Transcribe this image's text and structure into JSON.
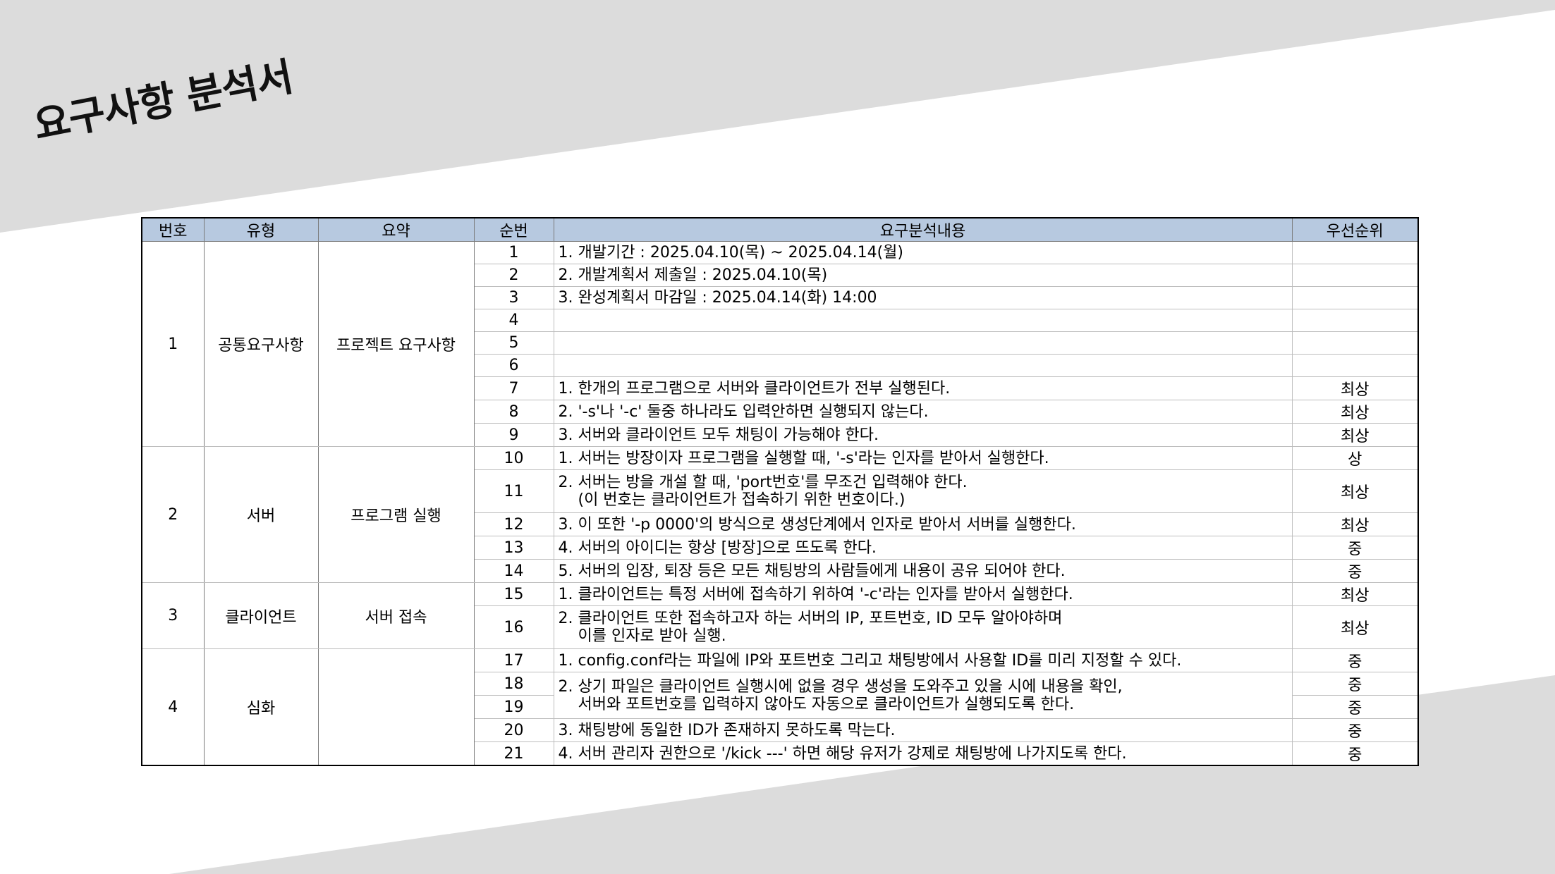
{
  "title": "요구사항 분석서",
  "colors": {
    "header_bg": "#b7c9e0",
    "band_gray": "#dcdcdc"
  },
  "table": {
    "headers": [
      "번호",
      "유형",
      "요약",
      "순번",
      "요구분석내용",
      "우선순위"
    ],
    "groups": [
      {
        "number": "1",
        "type": "공통요구사항",
        "summary": "프로젝트 요구사항",
        "rows": [
          {
            "seq": "1",
            "content": "1. 개발기간 : 2025.04.10(목) ~ 2025.04.14(월)",
            "priority": ""
          },
          {
            "seq": "2",
            "content": "2. 개발계획서 제출일 : 2025.04.10(목)",
            "priority": ""
          },
          {
            "seq": "3",
            "content": "3. 완성계획서 마감일 : 2025.04.14(화) 14:00",
            "priority": ""
          },
          {
            "seq": "4",
            "content": "",
            "priority": ""
          },
          {
            "seq": "5",
            "content": "",
            "priority": ""
          },
          {
            "seq": "6",
            "content": "",
            "priority": ""
          },
          {
            "seq": "7",
            "content": "1. 한개의 프로그램으로 서버와 클라이언트가 전부 실행된다.",
            "priority": "최상"
          },
          {
            "seq": "8",
            "content": "2. '-s'나 '-c' 둘중 하나라도 입력안하면 실행되지 않는다.",
            "priority": "최상"
          },
          {
            "seq": "9",
            "content": "3. 서버와 클라이언트 모두 채팅이 가능해야 한다.",
            "priority": "최상"
          }
        ]
      },
      {
        "number": "2",
        "type": "서버",
        "summary": "프로그램 실행",
        "rows": [
          {
            "seq": "10",
            "content": "1. 서버는 방장이자 프로그램을 실행할 때, '-s'라는 인자를 받아서 실행한다.",
            "priority": "상"
          },
          {
            "seq": "11",
            "content": "2. 서버는 방을 개설 할 때, 'port번호'를 무조건 입력해야 한다.\n    (이 번호는 클라이언트가 접속하기 위한 번호이다.)",
            "priority": "최상"
          },
          {
            "seq": "12",
            "content": "3. 이 또한 '-p 0000'의 방식으로 생성단계에서 인자로 받아서 서버를 실행한다.",
            "priority": "최상"
          },
          {
            "seq": "13",
            "content": "4. 서버의 아이디는 항상 [방장]으로 뜨도록 한다.",
            "priority": "중"
          },
          {
            "seq": "14",
            "content": "5. 서버의 입장, 퇴장 등은 모든 채팅방의 사람들에게 내용이 공유 되어야 한다.",
            "priority": "중"
          }
        ]
      },
      {
        "number": "3",
        "type": "클라이언트",
        "summary": "서버 접속",
        "rows": [
          {
            "seq": "15",
            "content": "1. 클라이언트는 특정 서버에 접속하기 위하여 '-c'라는 인자를 받아서 실행한다.",
            "priority": "최상"
          },
          {
            "seq": "16",
            "content": "2. 클라이언트 또한 접속하고자 하는 서버의 IP, 포트번호, ID 모두 알아야하며\n    이를 인자로 받아 실행.",
            "priority": "최상"
          }
        ]
      },
      {
        "number": "4",
        "type": "심화",
        "summary": "",
        "rows": [
          {
            "seq": "17",
            "content": "1. config.conf라는 파일에 IP와 포트번호 그리고 채팅방에서 사용할 ID를 미리 지정할 수 있다.",
            "priority": "중"
          },
          {
            "seq": "18",
            "content": "2. 상기 파일은 클라이언트 실행시에 없을 경우 생성을 도와주고 있을 시에 내용을 확인,\n    서버와 포트번호를 입력하지 않아도 자동으로 클라이언트가 실행되도록 한다.",
            "priority": "중",
            "content_rowspan": 2
          },
          {
            "seq": "19",
            "priority": "중"
          },
          {
            "seq": "20",
            "content": "3. 채팅방에 동일한 ID가 존재하지 못하도록 막는다.",
            "priority": "중"
          },
          {
            "seq": "21",
            "content": "4. 서버 관리자 권한으로 '/kick ---' 하면 해당 유저가 강제로 채팅방에 나가지도록 한다.",
            "priority": "중"
          }
        ]
      }
    ]
  }
}
